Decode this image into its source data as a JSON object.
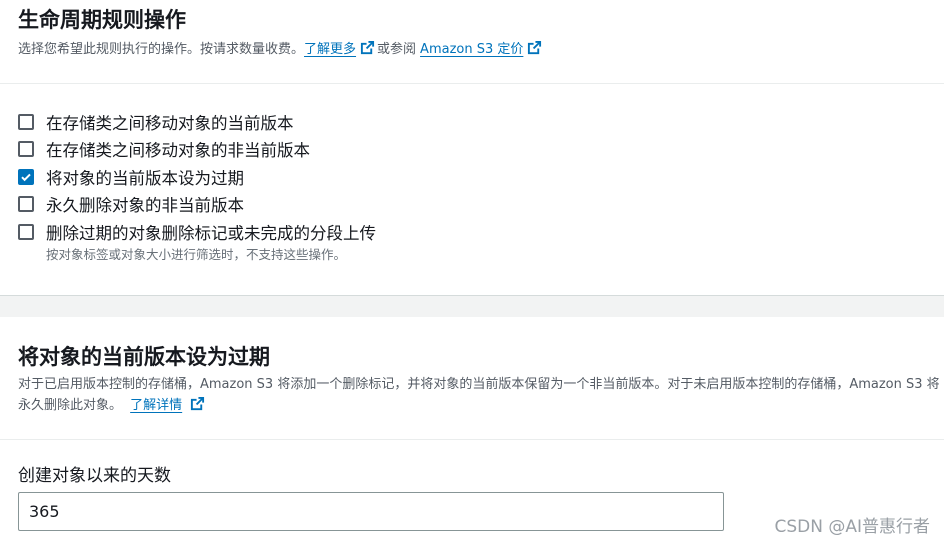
{
  "section1": {
    "title": "生命周期规则操作",
    "description": "选择您希望此规则执行的操作。按请求数量收费。",
    "learn_more_link": "了解更多",
    "or_see": "或参阅",
    "pricing_link": "Amazon S3 定价",
    "actions": [
      {
        "label": "在存储类之间移动对象的当前版本",
        "checked": false
      },
      {
        "label": "在存储类之间移动对象的非当前版本",
        "checked": false
      },
      {
        "label": "将对象的当前版本设为过期",
        "checked": true
      },
      {
        "label": "永久删除对象的非当前版本",
        "checked": false
      },
      {
        "label": "删除过期的对象删除标记或未完成的分段上传",
        "checked": false
      }
    ],
    "last_action_hint": "按对象标签或对象大小进行筛选时，不支持这些操作。"
  },
  "section2": {
    "title": "将对象的当前版本设为过期",
    "description": "对于已启用版本控制的存储桶，Amazon S3 将添加一个删除标记，并将对象的当前版本保留为一个非当前版本。对于未启用版本控制的存储桶，Amazon S3 将永久删除此对象。",
    "details_link": "了解详情",
    "days_label": "创建对象以来的天数",
    "days_value": "365"
  },
  "watermark": "CSDN @AI普惠行者",
  "colors": {
    "link": "#0073bb",
    "checkbox_checked": "#0073bb",
    "divider_bg": "#f2f3f3"
  },
  "icons": [
    "external-link-icon",
    "checkmark-icon"
  ]
}
